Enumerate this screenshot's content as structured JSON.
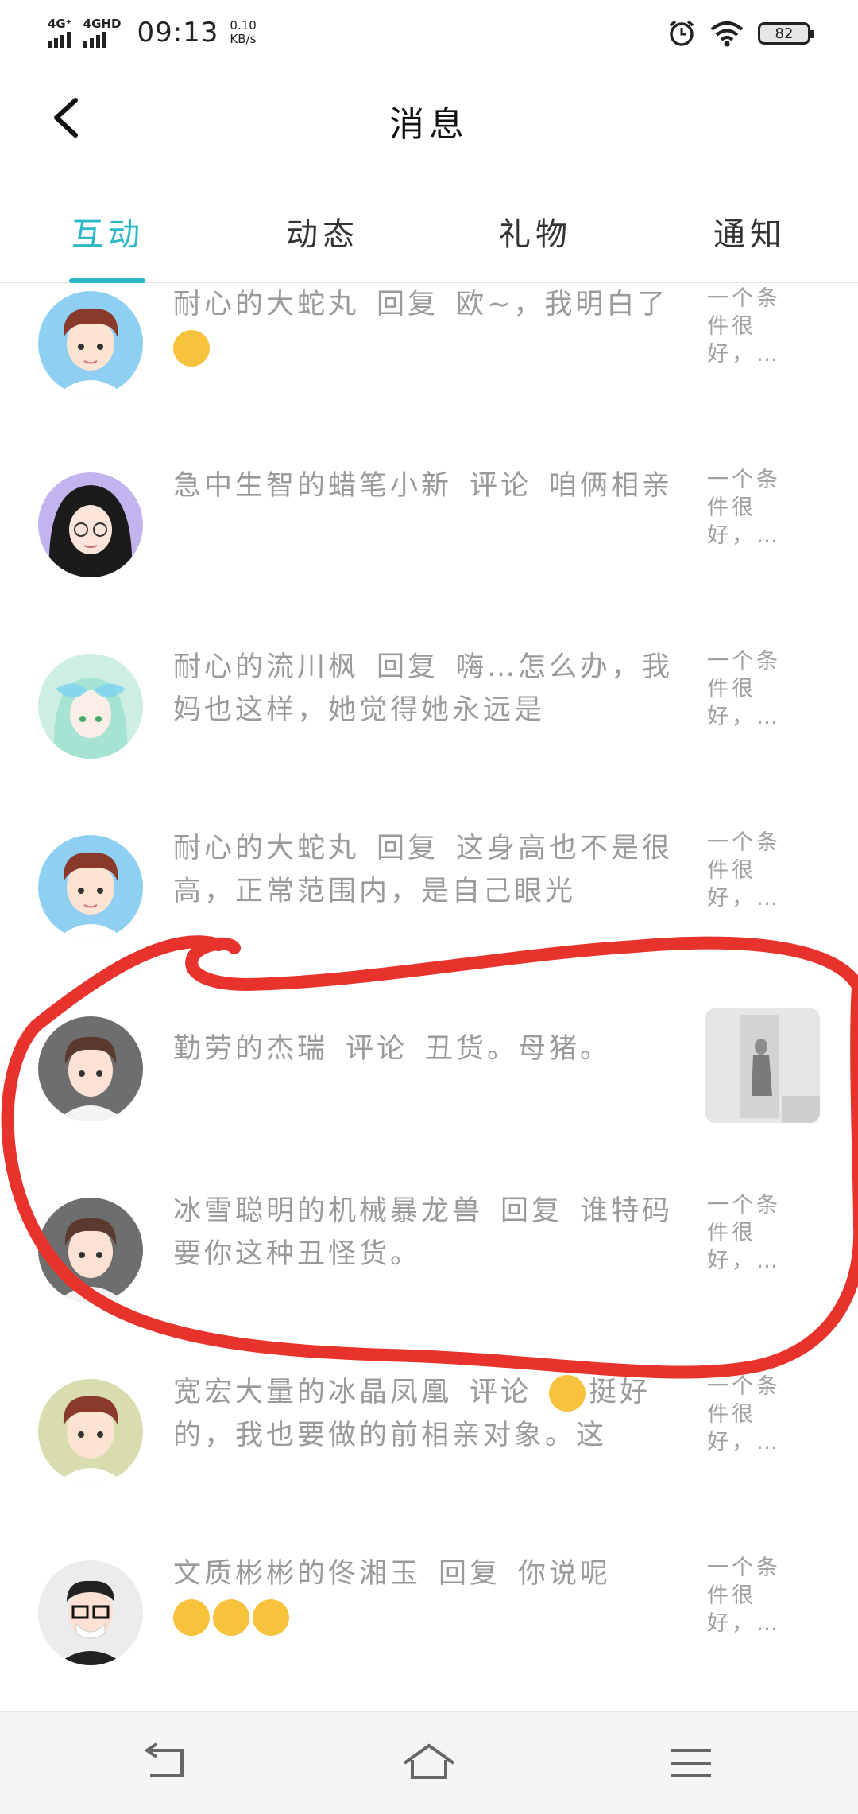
{
  "status_bar": {
    "net1": "4G⁺",
    "net2": "4GHD",
    "time": "09:13",
    "speed_value": "0.10",
    "speed_unit": "KB/s",
    "battery": "82",
    "icons": [
      "signal-icon",
      "alarm-icon",
      "wifi-icon",
      "battery-icon"
    ]
  },
  "header": {
    "title": "消息",
    "back_icon": "chevron-left-icon"
  },
  "tabs": [
    {
      "label": "互动",
      "active": true
    },
    {
      "label": "动态",
      "active": false
    },
    {
      "label": "礼物",
      "active": false
    },
    {
      "label": "通知",
      "active": false
    }
  ],
  "messages": [
    {
      "user": "耐心的大蛇丸",
      "action": "回复",
      "text": "欧~，我明白了",
      "emoji": "crying-emoji",
      "side": "一个条件很好，…"
    },
    {
      "user": "急中生智的蜡笔小新",
      "action": "评论",
      "text": "咱俩相亲",
      "side": "一个条件很好，…"
    },
    {
      "user": "耐心的流川枫",
      "action": "回复",
      "text": "嗨…怎么办，我妈也这样，她觉得她永远是",
      "side": "一个条件很好，…"
    },
    {
      "user": "耐心的大蛇丸",
      "action": "回复",
      "text": "这身高也不是很高，正常范围内，是自己眼光",
      "side": "一个条件很好，…"
    },
    {
      "user": "勤劳的杰瑞",
      "action": "评论",
      "text": "丑货。母猪。",
      "side_image": "photo-thumbnail"
    },
    {
      "user": "冰雪聪明的机械暴龙兽",
      "action": "回复",
      "text": "谁特码要你这种丑怪货。",
      "side": "一个条件很好，…"
    },
    {
      "user": "宽宏大量的冰晶凤凰",
      "action": "评论",
      "text": "挺好的，我也要做的前相亲对象。这",
      "emoji": "thinking-emoji",
      "side": "一个条件很好，…"
    },
    {
      "user": "文质彬彬的佟湘玉",
      "action": "回复",
      "text": "你说呢",
      "emoji": "love-emoji",
      "side": "一个条件很好，…"
    }
  ],
  "annotation": {
    "color": "#e8322c"
  },
  "colors": {
    "accent": "#2bb9c7",
    "text_muted": "#9a9a9a"
  },
  "system_nav": [
    "back-nav-icon",
    "home-nav-icon",
    "menu-nav-icon"
  ]
}
